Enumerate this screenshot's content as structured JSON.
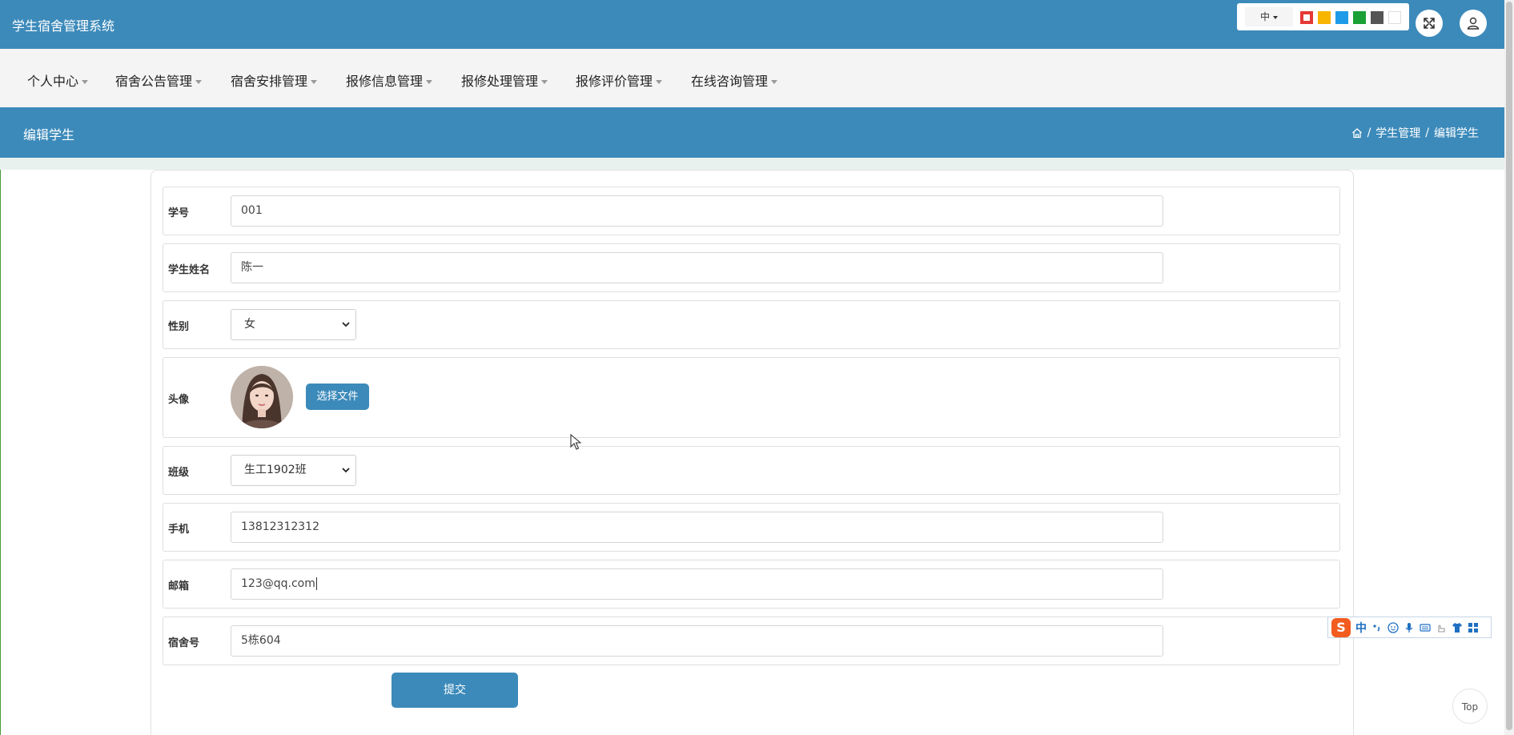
{
  "app": {
    "title": "学生宿舍管理系统"
  },
  "theme": {
    "lang_label": "中",
    "swatches": [
      "#e53935",
      "#f7b500",
      "#1e9be8",
      "#1aa035",
      "#555555",
      "#ffffff"
    ],
    "accent": "#3c8aba"
  },
  "nav": {
    "items": [
      {
        "label": "个人中心"
      },
      {
        "label": "宿舍公告管理"
      },
      {
        "label": "宿舍安排管理"
      },
      {
        "label": "报修信息管理"
      },
      {
        "label": "报修处理管理"
      },
      {
        "label": "报修评价管理"
      },
      {
        "label": "在线咨询管理"
      }
    ]
  },
  "page": {
    "title": "编辑学生",
    "breadcrumb": [
      "学生管理",
      "编辑学生"
    ],
    "breadcrumb_sep": "/"
  },
  "form": {
    "student_id": {
      "label": "学号",
      "value": "001"
    },
    "name": {
      "label": "学生姓名",
      "value": "陈一"
    },
    "gender": {
      "label": "性别",
      "value": "女"
    },
    "avatar": {
      "label": "头像",
      "button": "选择文件"
    },
    "class": {
      "label": "班级",
      "value": "生工1902班"
    },
    "phone": {
      "label": "手机",
      "value": "13812312312"
    },
    "email": {
      "label": "邮箱",
      "value": "123@qq.com"
    },
    "dorm": {
      "label": "宿舍号",
      "value": "5栋604"
    },
    "submit": "提交"
  },
  "ime": {
    "logo": "S",
    "mode": "中"
  },
  "top_button": "Top",
  "icons": [
    "fullscreen-icon",
    "user-icon",
    "home-icon",
    "chevron-down-icon",
    "cursor-icon"
  ]
}
